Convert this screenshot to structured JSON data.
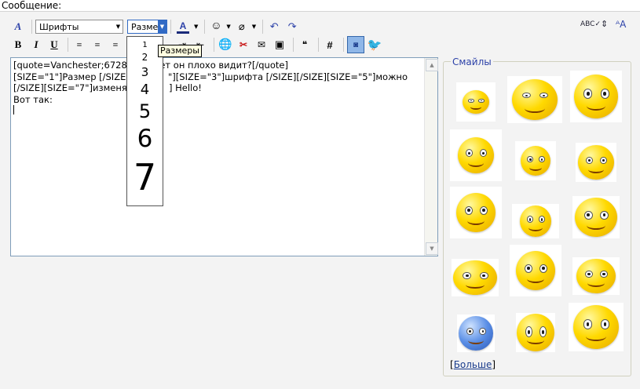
{
  "header": {
    "label": "Сообщение:"
  },
  "toolbar": {
    "font_select": "Шрифты",
    "size_select": "Разме",
    "bold": "B",
    "italic": "I",
    "underline": "U",
    "hash": "#",
    "spellcheck": "ABC"
  },
  "size_dropdown": {
    "items": [
      "1",
      "2",
      "3",
      "4",
      "5",
      "6",
      "7"
    ],
    "tooltip": "Размеры"
  },
  "editor": {
    "lines": [
      "[quote=Vanchester;67284",
      "[SIZE=\"1\"]Размер [/SIZE]",
      "[/SIZE][SIZE=\"7\"]изменят",
      "Вот так:"
    ],
    "line1_tail": "жет он плохо видит?[/quote]",
    "line2_tail": "\"][SIZE=\"3\"]шрифта [/SIZE][/SIZE][SIZE=\"5\"]можно",
    "line3_tail": "] Hello!"
  },
  "smilies": {
    "legend": "Смайлы",
    "more_link": "Больше"
  },
  "colors": {
    "accent": "#2c41a8",
    "face_yellow": "#ffd900",
    "face_blue": "#5b8fe6"
  }
}
